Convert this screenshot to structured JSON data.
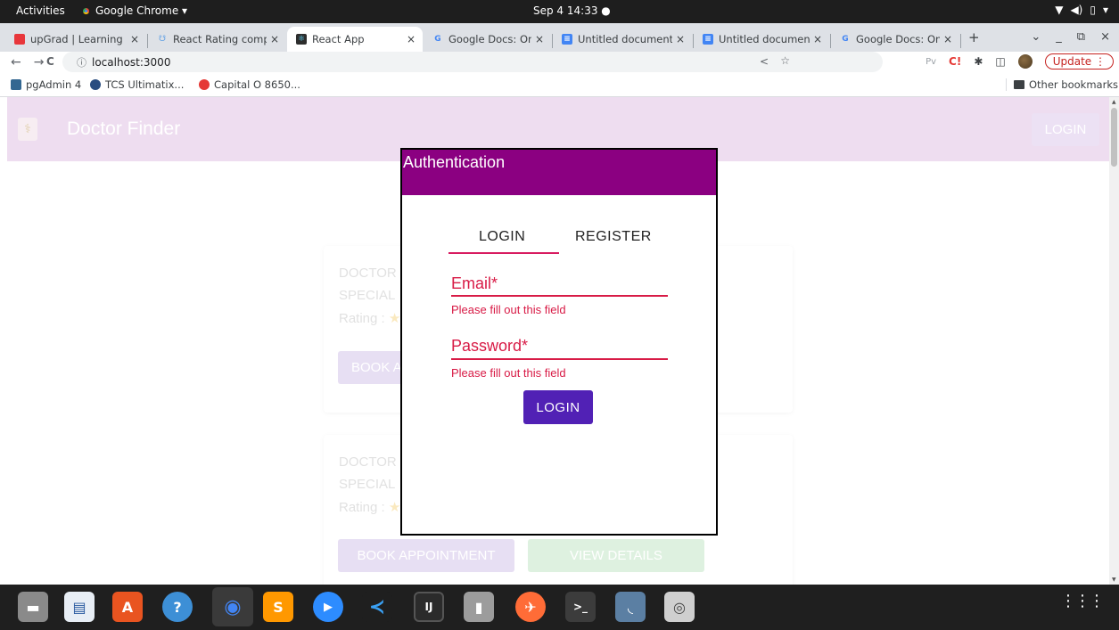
{
  "topbar": {
    "activities": "Activities",
    "app_name": "Google Chrome ▾",
    "clock": "Sep 4  14:33  ●",
    "tray": [
      "▼",
      "◀)",
      "▯",
      "▾"
    ]
  },
  "tabs": [
    {
      "title": "upGrad | Learning F",
      "close": "×",
      "icon_color": "#e8363b"
    },
    {
      "title": "React Rating compo",
      "close": "×",
      "icon_color": "#61a0e4"
    },
    {
      "title": "React App",
      "close": "×",
      "icon_color": "#2d2d2d"
    },
    {
      "title": "Google Docs: Onlin",
      "close": "×",
      "icon_color": "#4285f4"
    },
    {
      "title": "Untitled document",
      "close": "×",
      "icon_color": "#4285f4"
    },
    {
      "title": "Untitled document",
      "close": "×",
      "icon_color": "#4285f4"
    },
    {
      "title": "Google Docs: Onlin",
      "close": "×",
      "icon_color": "#4285f4"
    }
  ],
  "tabstrip": {
    "new_tab": "+",
    "dropdown": "⌄",
    "minimize": "_",
    "restore": "⧉",
    "close": "×"
  },
  "toolbar": {
    "back": "←",
    "forward": "→",
    "reload": "C",
    "info": "ⓘ",
    "url": "localhost:3000",
    "share": "<",
    "star": "☆",
    "ext_pv": "Pv",
    "ext_c": "C!",
    "puzzle": "✱",
    "sidepanel": "◫",
    "update_label": "Update ⋮"
  },
  "bookmarks": {
    "items": [
      {
        "label": "pgAdmin 4",
        "icon_color": "#336791"
      },
      {
        "label": "TCS Ultimatix...",
        "icon_color": "#2a4d80"
      },
      {
        "label": "Capital O 8650...",
        "icon_color": "#e53935"
      }
    ],
    "other": "Other bookmarks"
  },
  "app": {
    "brand": "Doctor Finder",
    "login_button": "LOGIN",
    "cards": [
      {
        "line1": "DOCTOR",
        "line2": "SPECIAL",
        "line3": "Rating : ",
        "star": "★",
        "book": "BOOK A"
      },
      {
        "line1": "DOCTOR",
        "line2": "SPECIAL",
        "line3": "Rating : ",
        "star": "★",
        "book": "BOOK APPOINTMENT",
        "details": "VIEW DETAILS"
      }
    ]
  },
  "modal": {
    "title": "Authentication",
    "tabs": {
      "login": "LOGIN",
      "register": "REGISTER"
    },
    "email_label": "Email*",
    "email_error": "Please fill out this field",
    "password_label": "Password*",
    "password_error": "Please fill out this field",
    "submit": "LOGIN"
  },
  "dock": {
    "apps": [
      {
        "name": "files",
        "glyph": "▬",
        "bg": "#8a8a8a"
      },
      {
        "name": "writer",
        "glyph": "▤",
        "bg": "#e8eef5"
      },
      {
        "name": "software",
        "glyph": "A",
        "bg": "#e95420"
      },
      {
        "name": "help",
        "glyph": "?",
        "bg": "#3d8fd6"
      },
      {
        "name": "chrome",
        "glyph": "◉",
        "bg": "#3a3a3a"
      },
      {
        "name": "sublime",
        "glyph": "S",
        "bg": "#ff9800"
      },
      {
        "name": "zoom",
        "glyph": "▶",
        "bg": "#2d8cff"
      },
      {
        "name": "vscode",
        "glyph": "≺",
        "bg": "#1f1f1f"
      },
      {
        "name": "intellij",
        "glyph": "IJ",
        "bg": "#2b2b2b"
      },
      {
        "name": "archive",
        "glyph": "▮",
        "bg": "#9c9c9c"
      },
      {
        "name": "postman",
        "glyph": "✈",
        "bg": "#ff6c37"
      },
      {
        "name": "terminal",
        "glyph": ">_",
        "bg": "#3c3c3c"
      },
      {
        "name": "workbench",
        "glyph": "◟",
        "bg": "#5b7fa3"
      },
      {
        "name": "search",
        "glyph": "◎",
        "bg": "#cfcfcf"
      }
    ],
    "grid": "⋮⋮⋮"
  }
}
